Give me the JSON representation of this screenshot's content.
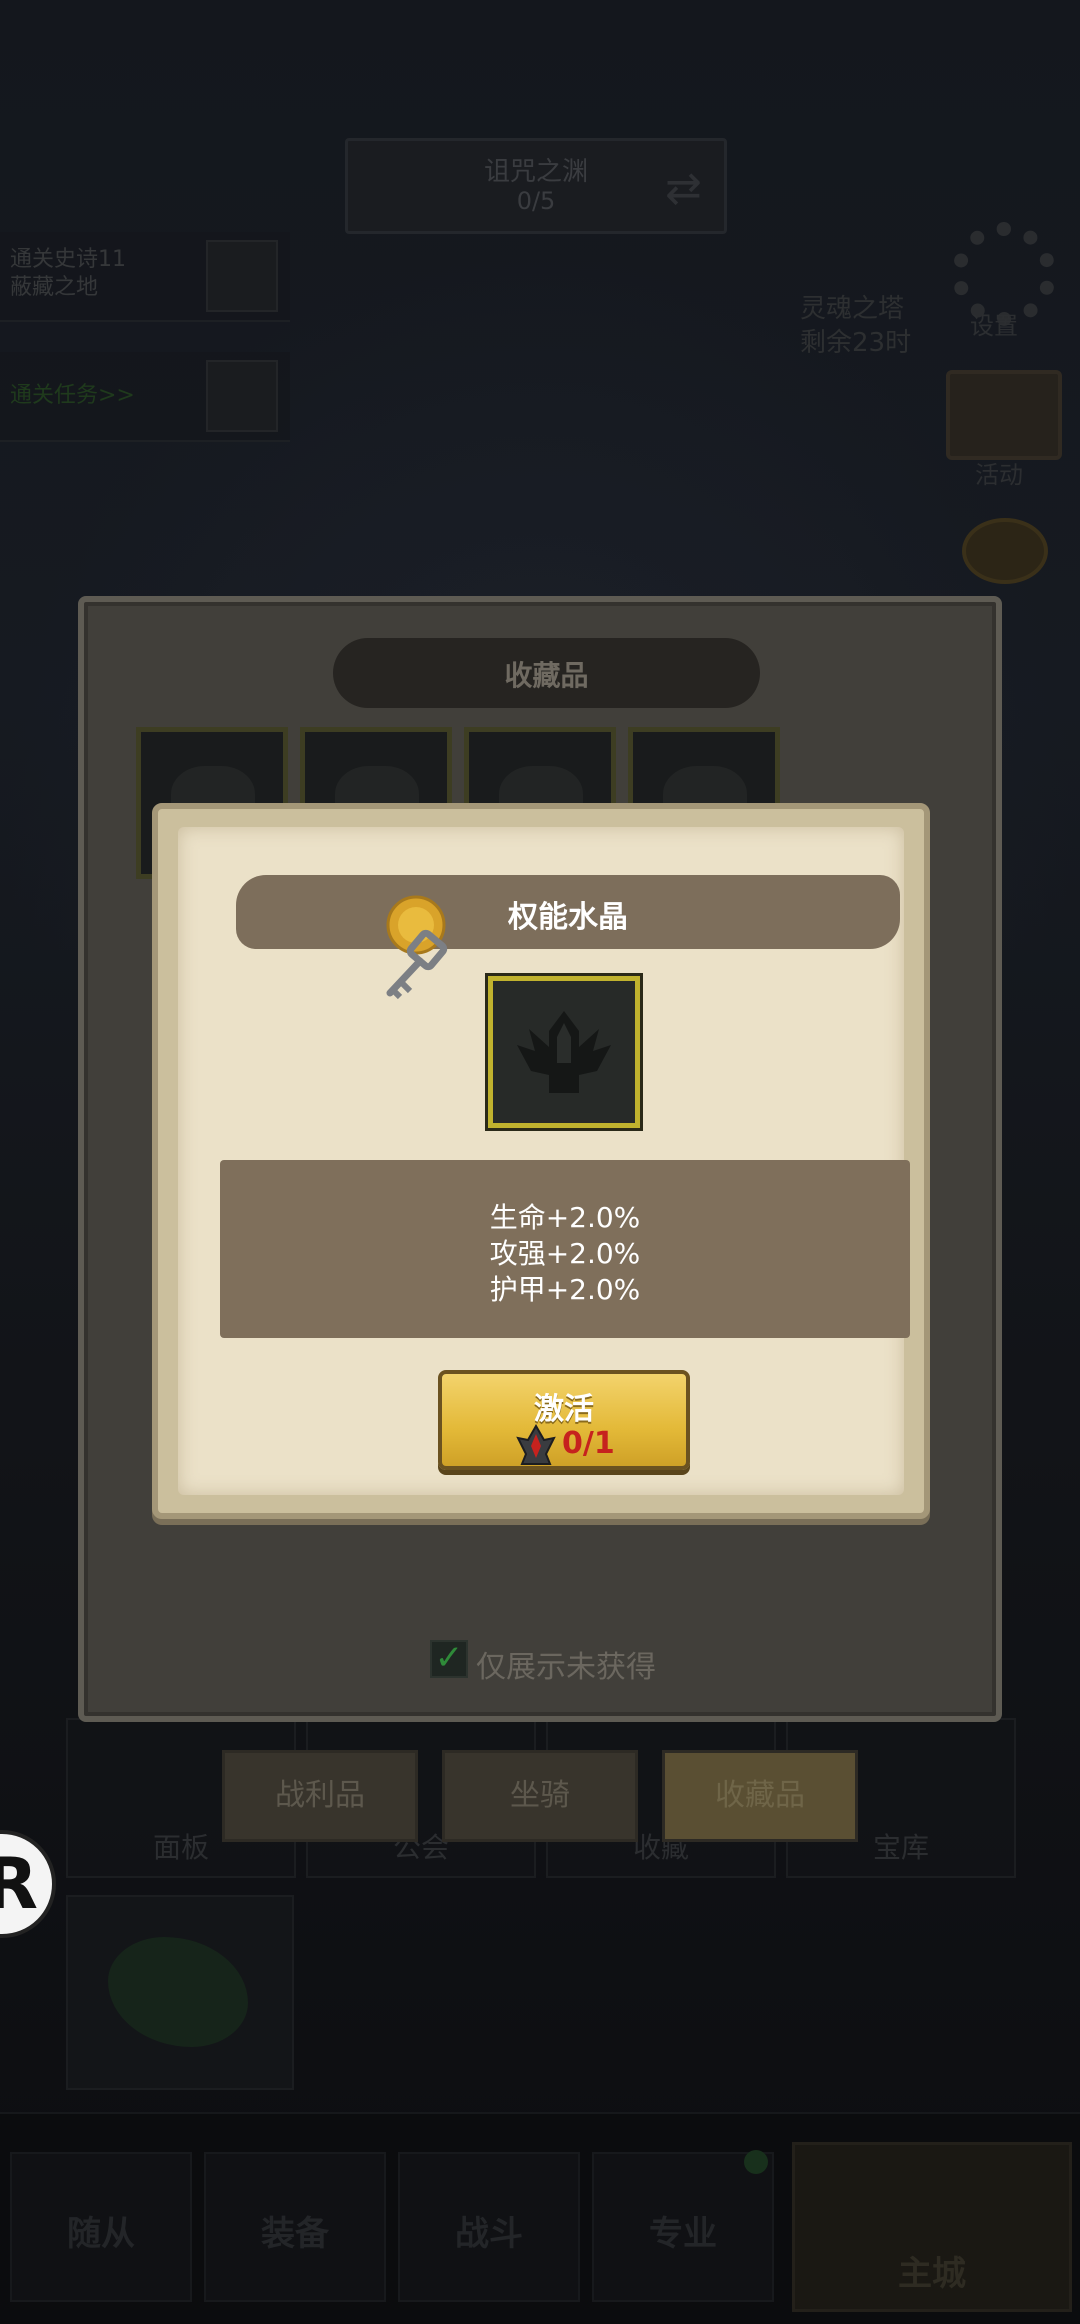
{
  "background": {
    "stage": {
      "title": "诅咒之渊",
      "count": "0/5"
    },
    "quests": [
      {
        "text1": "通关史诗11",
        "text2": "蔽藏之地",
        "green": false
      },
      {
        "text1": "通关任务>>",
        "text2": "",
        "green": true
      }
    ],
    "right_text": [
      "灵魂之塔",
      "剩余23时"
    ],
    "gear_label": "设置",
    "chest_label": "活动",
    "nav_cells": [
      "面板",
      "公会",
      "收藏",
      "宝库"
    ],
    "bottom_tabs": [
      "随从",
      "装备",
      "战斗",
      "专业"
    ],
    "bottom_main": "主城",
    "r_badge": "R"
  },
  "panel": {
    "title": "收藏品",
    "filter_label": "仅展示未获得",
    "filter_checked": true,
    "tabs": [
      {
        "label": "战利品",
        "active": false
      },
      {
        "label": "坐骑",
        "active": false
      },
      {
        "label": "收藏品",
        "active": true
      }
    ]
  },
  "popup": {
    "title": "权能水晶",
    "stats": [
      "生命+2.0%",
      "攻强+2.0%",
      "护甲+2.0%"
    ],
    "button_label": "激活",
    "cost": "0/1",
    "icons": {
      "key": "key-icon",
      "item": "crown-silhouette-icon",
      "cost": "crystal-icon"
    }
  },
  "colors": {
    "accent_gold": "#e3b938",
    "cost_red": "#c6221e",
    "frame_gold": "#c0b22e"
  }
}
